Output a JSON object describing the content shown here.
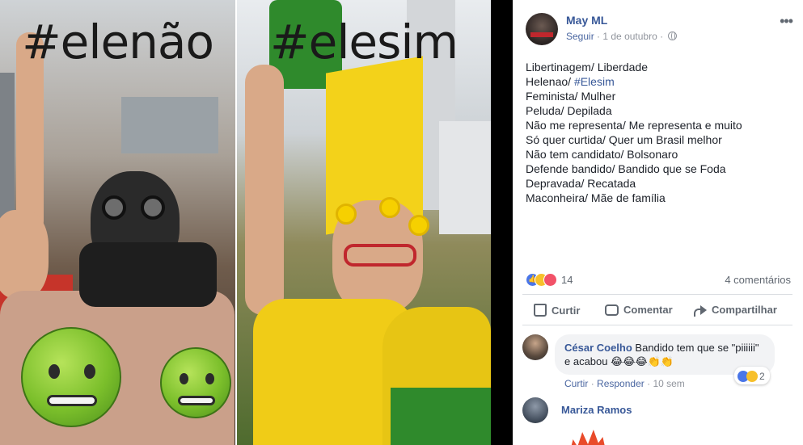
{
  "image": {
    "left_hashtag": "#elenão",
    "right_hashtag": "#elesim"
  },
  "post": {
    "author": "May ML",
    "follow_label": "Seguir",
    "separator": "·",
    "date": "1 de outubro",
    "privacy_icon": "globe-icon",
    "more_icon": "more-options-icon",
    "more_glyph": "•••",
    "text_lines": [
      "Libertinagem/ Liberdade",
      "Helenao/ ",
      "Feminista/ Mulher",
      "Peluda/ Depilada",
      "Não me representa/ Me representa e muito",
      "Só quer curtida/ Quer um Brasil melhor",
      "Não tem candidato/ Bolsonaro",
      "Defende bandido/ Bandido que se Foda",
      "Depravada/ Recatada",
      "Maconheira/ Mãe de família"
    ],
    "hashtag_link": "#Elesim"
  },
  "reactions": {
    "icons": [
      "like-icon",
      "haha-icon",
      "love-icon"
    ],
    "count": "14",
    "comments": "4 comentários"
  },
  "actions": {
    "like": "Curtir",
    "comment": "Comentar",
    "share": "Compartilhar"
  },
  "comments": [
    {
      "name": "César Coelho",
      "text_first": " Bandido tem que se \"piiiiii\"",
      "text_second": "e acabou 😂😂😂👏👏",
      "reaction_count": "2",
      "like_link": "Curtir",
      "reply_link": "Responder",
      "age": "10 sem"
    },
    {
      "name": "Mariza Ramos"
    }
  ],
  "colors": {
    "link_blue": "#385898",
    "meta_gray": "#90949c",
    "text": "#1d2129",
    "like_blue": "#4a76e8"
  }
}
